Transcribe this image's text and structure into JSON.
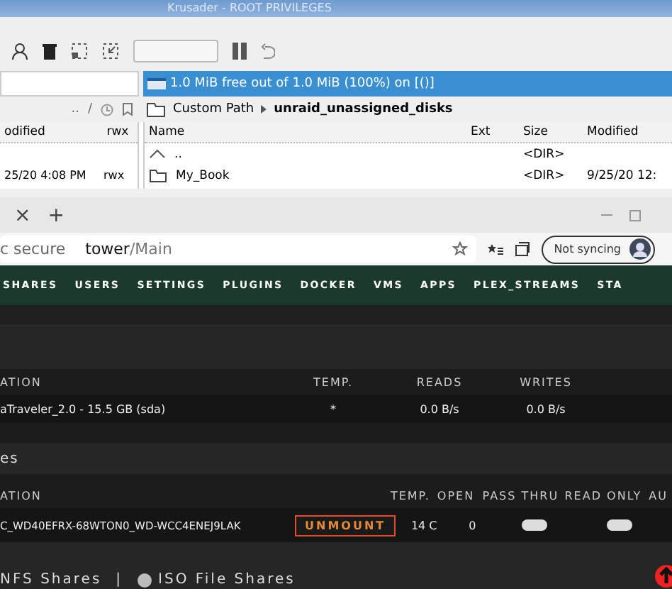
{
  "window": {
    "title": "Krusader - ROOT PRIVILEGES"
  },
  "free_space": "1.0 MiB free out of 1.0 MiB (100%) on  [()]",
  "left_panel": {
    "crumbs": [
      "..",
      "/"
    ],
    "columns": [
      "odified",
      "rwx"
    ],
    "rows": [
      [
        "25/20 4:08 PM",
        "rwx"
      ]
    ]
  },
  "right_panel": {
    "path_label": "Custom Path",
    "path": "unraid_unassigned_disks",
    "columns": [
      "Name",
      "Ext",
      "Size",
      "Modified"
    ],
    "rows": [
      {
        "kind": "up",
        "name": "..",
        "size": "<DIR>",
        "modified": ""
      },
      {
        "kind": "folder",
        "name": "My_Book",
        "size": "<DIR>",
        "modified": "9/25/20 12:"
      }
    ]
  },
  "browser": {
    "tab_close": "×",
    "new_tab": "+",
    "security": "c secure",
    "host": "tower",
    "path": "/Main",
    "sync": "Not syncing"
  },
  "nav": [
    "SHARES",
    "USERS",
    "SETTINGS",
    "PLUGINS",
    "DOCKER",
    "VMS",
    "APPS",
    "PLEX_STREAMS",
    "STA"
  ],
  "boot_table": {
    "columns": [
      "ATION",
      "TEMP.",
      "READS",
      "WRITES"
    ],
    "rows": [
      [
        "aTraveler_2.0 - 15.5 GB (sda)",
        "*",
        "0.0 B/s",
        "0.0 B/s"
      ]
    ]
  },
  "section_title": "es",
  "devices_table": {
    "columns": [
      "ATION",
      "TEMP.",
      "OPEN",
      "PASS THRU",
      "READ ONLY",
      "AU"
    ],
    "rows": [
      {
        "device": "C_WD40EFRX-68WTON0_WD-WCC4ENEJ9LAK",
        "button": "UNMOUNT",
        "temp": "14 C",
        "open": "0",
        "pass_thru": false,
        "read_only": false
      }
    ]
  },
  "footer": {
    "links": [
      "NFS Shares",
      "ISO File Shares"
    ],
    "separator": "|"
  }
}
